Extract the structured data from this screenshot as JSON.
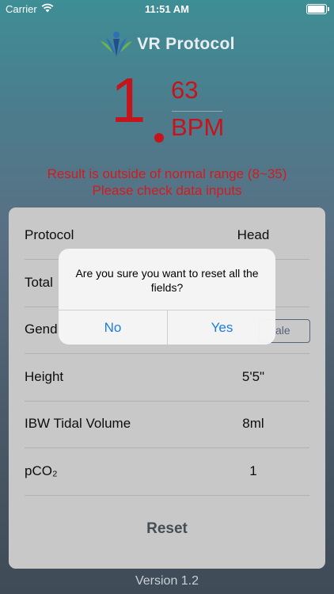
{
  "status_bar": {
    "carrier": "Carrier",
    "time": "11:51 AM",
    "battery_level": 1.0
  },
  "header": {
    "title": "VR Protocol"
  },
  "result": {
    "integer": "1",
    "decimal": "63",
    "unit": "BPM",
    "warning_line1": "Result is outside of normal range (8~35)",
    "warning_line2": "Please check data inputs"
  },
  "form": {
    "rows": [
      {
        "label": "Protocol",
        "value": "Head"
      },
      {
        "label": "Total",
        "value": ""
      },
      {
        "label": "Gend",
        "value": "ale"
      },
      {
        "label": "Height",
        "value": "5'5\""
      },
      {
        "label": "IBW Tidal Volume",
        "value": "8ml"
      },
      {
        "label": "pCO₂",
        "value": "1"
      }
    ],
    "reset_label": "Reset"
  },
  "footer": {
    "version": "Version 1.2"
  },
  "alert": {
    "message": "Are you sure you want to reset all the fields?",
    "no_label": "No",
    "yes_label": "Yes"
  },
  "colors": {
    "result_red": "#c4151c",
    "ios_blue": "#1a7ce6",
    "gradient_top": "#3e8e95",
    "gradient_bottom": "#3f4b57"
  }
}
